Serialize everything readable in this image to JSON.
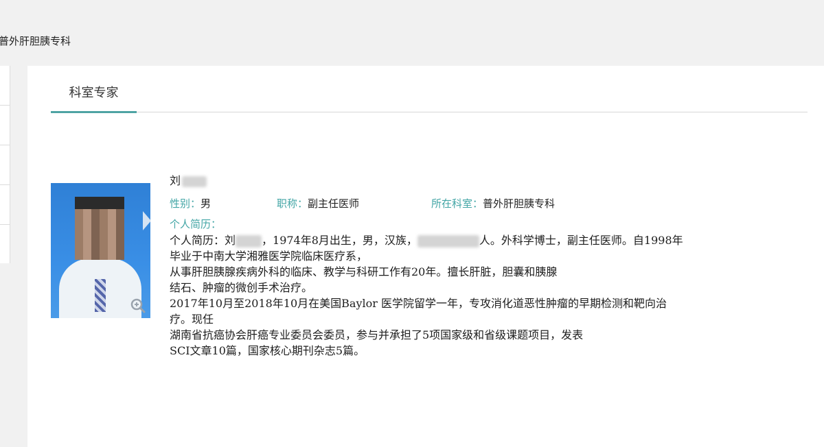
{
  "header": {
    "title": "普外肝胆胰专科"
  },
  "tabs": [
    {
      "label": "科室专家",
      "active": true
    }
  ],
  "doctor": {
    "name_visible": "刘",
    "gender_label": "性别：",
    "gender": "男",
    "title_label": "职称：",
    "title": "副主任医师",
    "dept_label": "所在科室：",
    "dept": "普外肝胆胰专科",
    "bio_label": "个人简历：",
    "bio": {
      "line1_a": "个人简历：刘",
      "line1_b": "，1974年8月出生，男，汉族，",
      "line1_c": "人。外科学博士，副主任医师。自1998年",
      "line2": "毕业于中南大学湘雅医学院临床医疗系，",
      "line3": "从事肝胆胰腺疾病外科的临床、教学与科研工作有20年。擅长肝脏，胆囊和胰腺",
      "line4": "结石、肿瘤的微创手术治疗。",
      "line5": "2017年10月至2018年10月在美国Baylor 医学院留学一年，专攻消化道恶性肿瘤的早期检测和靶向治",
      "line6": "疗。现任",
      "line7": "湖南省抗癌协会肝癌专业委员会委员，参与并承担了5项国家级和省级课题项目，发表",
      "line8": "SCI文章10篇，国家核心期刊杂志5篇。"
    }
  },
  "colors": {
    "accent": "#42a5a5",
    "tab_underline": "#4ea3a3",
    "photo_bg": "#2f80d6"
  },
  "icons": {
    "zoom": "zoom-in-icon",
    "side_arrow": "chevron-right-icon"
  }
}
